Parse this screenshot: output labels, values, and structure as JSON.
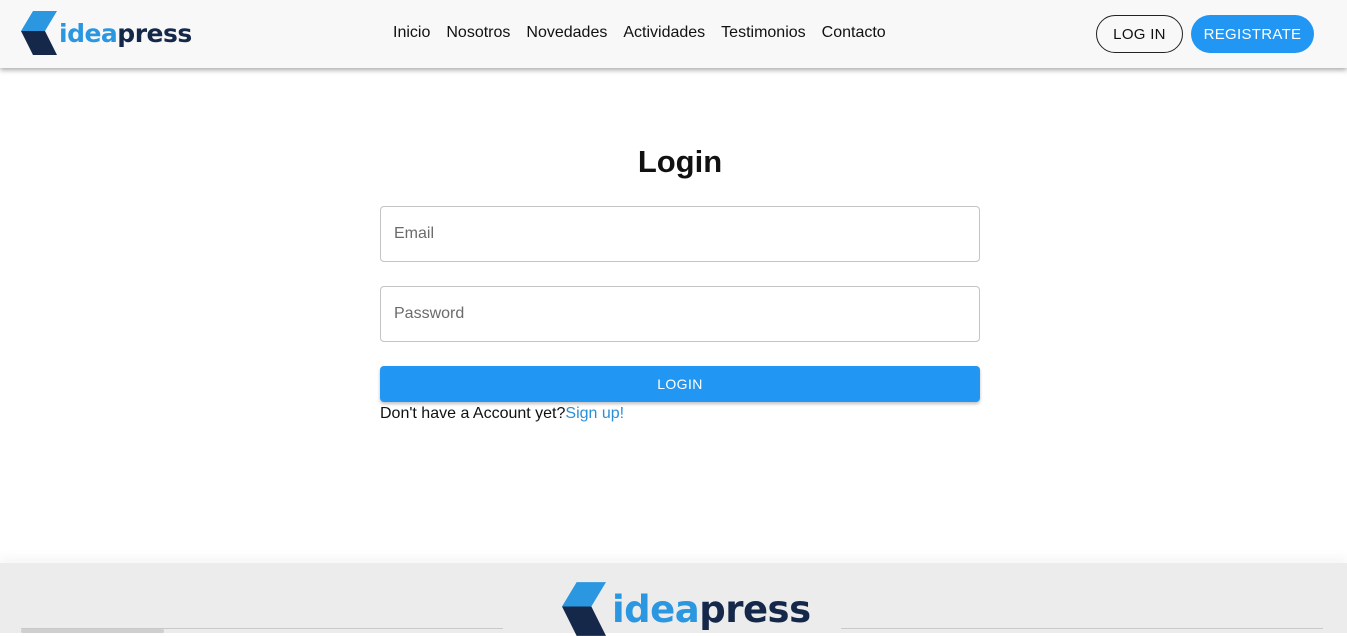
{
  "brand": {
    "part1": "idea",
    "part2": "press",
    "primary_color": "#2a97e0",
    "dark_color": "#16284a"
  },
  "nav": {
    "items": [
      {
        "label": "Inicio"
      },
      {
        "label": "Nosotros"
      },
      {
        "label": "Novedades"
      },
      {
        "label": "Actividades"
      },
      {
        "label": "Testimonios"
      },
      {
        "label": "Contacto"
      }
    ]
  },
  "header_buttons": {
    "login": "LOG IN",
    "register": "REGISTRATE"
  },
  "login_form": {
    "title": "Login",
    "email_placeholder": "Email",
    "password_placeholder": "Password",
    "submit_label": "LOGIN",
    "signup_prompt": "Don't have a Account yet?",
    "signup_link": "Sign up!"
  },
  "colors": {
    "accent": "#2196f3",
    "header_bg": "#f8f8f8",
    "footer_bg": "#ececec"
  }
}
